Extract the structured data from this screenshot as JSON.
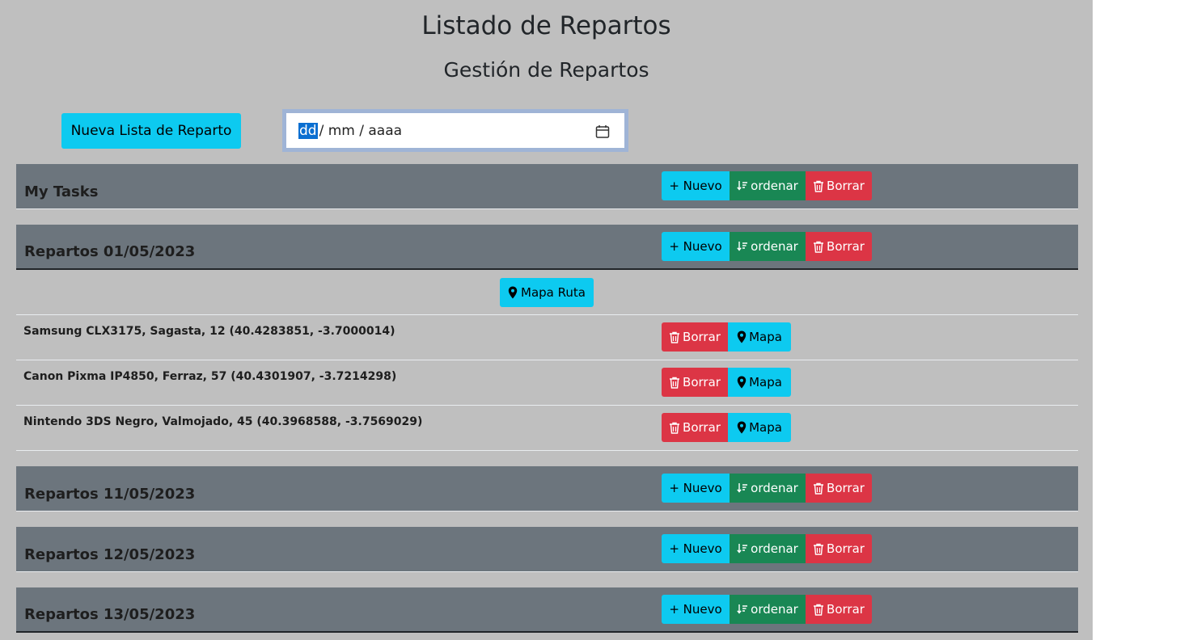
{
  "page": {
    "title": "Listado de Repartos",
    "subtitle": "Gestión de Repartos"
  },
  "toolbar": {
    "new_list_label": "Nueva Lista de Reparto",
    "date": {
      "dd": "dd",
      "rest": "/ mm / aaaa"
    }
  },
  "buttons": {
    "nuevo": "+ Nuevo",
    "ordenar": "ordenar",
    "borrar": "Borrar",
    "mapa": "Mapa",
    "mapa_ruta": "Mapa Ruta"
  },
  "groups": [
    {
      "title": "My Tasks"
    },
    {
      "title": "Repartos 01/05/2023",
      "items": [
        {
          "text": "Samsung CLX3175, Sagasta, 12 (40.4283851, -3.7000014)"
        },
        {
          "text": "Canon Pixma IP4850, Ferraz, 57 (40.4301907, -3.7214298)"
        },
        {
          "text": "Nintendo 3DS Negro, Valmojado, 45 (40.3968588, -3.7569029)"
        }
      ]
    },
    {
      "title": "Repartos 11/05/2023"
    },
    {
      "title": "Repartos 12/05/2023"
    },
    {
      "title": "Repartos 13/05/2023"
    }
  ],
  "colors": {
    "panel_bg": "#bfbfbf",
    "header_bg": "#6c757d",
    "info": "#0dcaf0",
    "success": "#198754",
    "danger": "#dc3545"
  },
  "icons": {
    "sort": "sort-down-icon",
    "trash": "trash-icon",
    "pin": "geo-pin-icon",
    "calendar": "calendar-icon"
  }
}
